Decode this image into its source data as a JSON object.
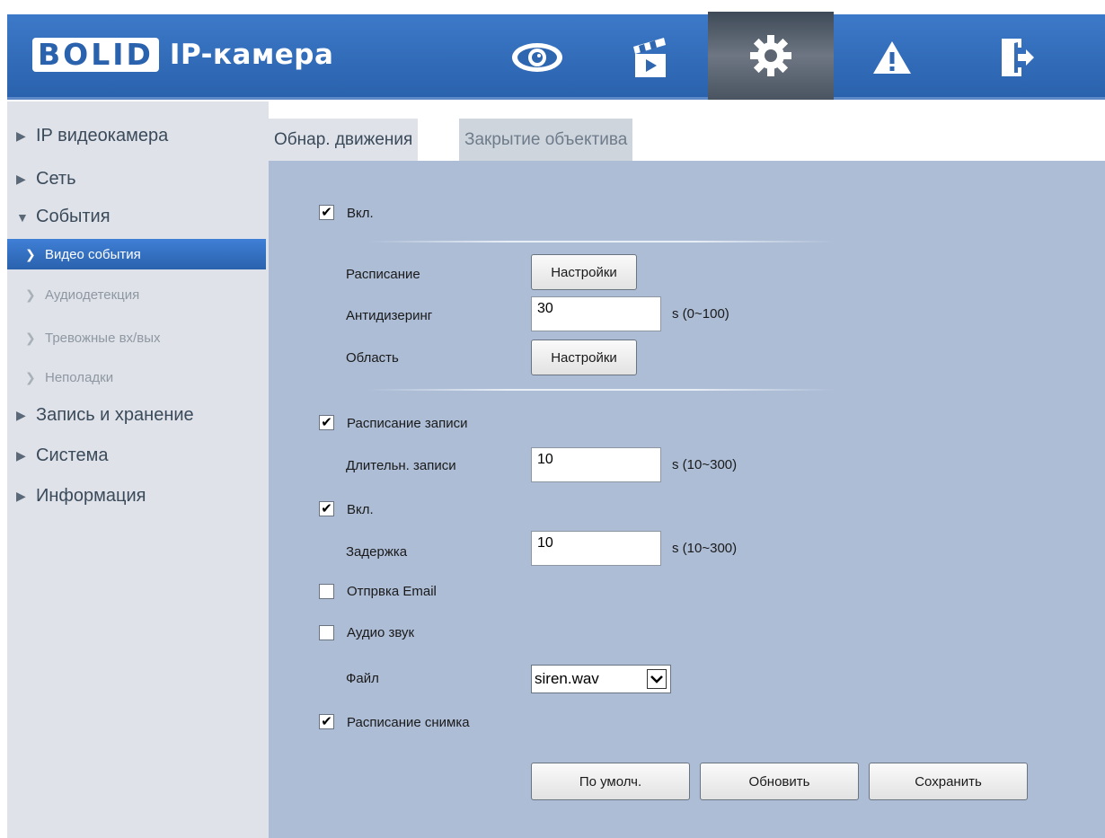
{
  "header": {
    "logo_text": "BOLID",
    "title": "IP-камера",
    "nav_icons": [
      "eye-icon",
      "clapperboard-icon",
      "gear-icon",
      "warning-icon",
      "logout-icon"
    ]
  },
  "sidebar": {
    "items": [
      {
        "label": "IP видеокамера"
      },
      {
        "label": "Сеть"
      },
      {
        "label": "События"
      },
      {
        "label": "Запись и хранение"
      },
      {
        "label": "Система"
      },
      {
        "label": "Информация"
      }
    ],
    "sub_items": [
      {
        "label": "Видео события"
      },
      {
        "label": "Аудиодетекция"
      },
      {
        "label": "Тревожные вх/вых"
      },
      {
        "label": "Неполадки"
      }
    ]
  },
  "tabs": [
    {
      "label": "Обнар. движения"
    },
    {
      "label": "Закрытие объектива"
    }
  ],
  "form": {
    "enable": {
      "label": "Вкл.",
      "checked": true
    },
    "schedule_label": "Расписание",
    "settings_button": "Настройки",
    "antidither": {
      "label": "Антидизеринг",
      "value": "30",
      "range": "s (0~100)"
    },
    "area_label": "Область",
    "record_schedule": {
      "label": "Расписание записи",
      "checked": true
    },
    "record_duration": {
      "label": "Длительн. записи",
      "value": "10",
      "range": "s (10~300)"
    },
    "relay": {
      "label": "Вкл.",
      "checked": true
    },
    "delay": {
      "label": "Задержка",
      "value": "10",
      "range": "s (10~300)"
    },
    "send_email": {
      "label": "Отпрвка Email",
      "checked": false
    },
    "audio": {
      "label": "Аудио звук",
      "checked": false
    },
    "file": {
      "label": "Файл",
      "value": "siren.wav"
    },
    "snapshot_schedule": {
      "label": "Расписание снимка",
      "checked": true
    }
  },
  "actions": {
    "default": "По умолч.",
    "refresh": "Обновить",
    "save": "Сохранить"
  },
  "colors": {
    "header": "#2a62ad",
    "content_bg": "#adbdd6",
    "sidebar_bg": "#dfe3e9",
    "active_item": "#3f7fd6"
  }
}
